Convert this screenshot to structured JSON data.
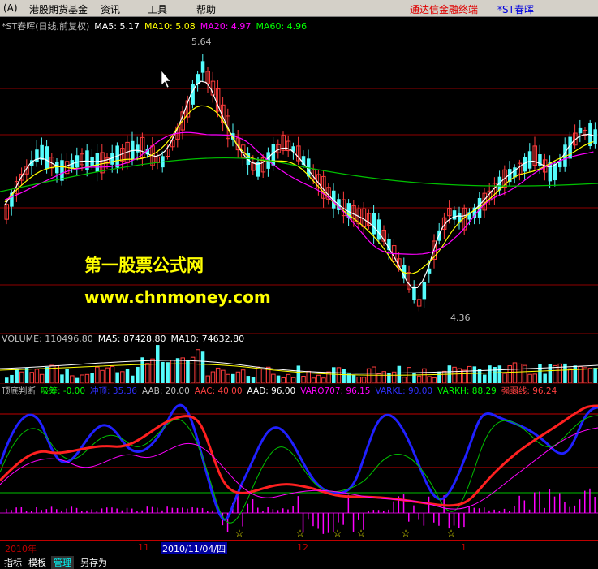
{
  "menu": {
    "items": [
      "(A)",
      "港股期货基金",
      "资讯",
      "工具",
      "帮助"
    ],
    "brand": "通达信金融终端",
    "stock": "*ST春晖"
  },
  "price_panel": {
    "legend": [
      {
        "text": "*ST春晖(日线,前复权)",
        "color": "#c0c0c0"
      },
      {
        "text": "MA5: 5.17",
        "color": "#ffffff"
      },
      {
        "text": "MA10: 5.08",
        "color": "#ffff00"
      },
      {
        "text": "MA20: 4.97",
        "color": "#ff00ff"
      },
      {
        "text": "MA60: 4.96",
        "color": "#00ff00"
      }
    ],
    "high_label": "5.64",
    "low_label": "4.36"
  },
  "watermark": {
    "line1": "第一股票公式网",
    "line2": "www.chnmoney.com"
  },
  "volume_panel": {
    "legend": [
      {
        "text": "VOLUME: 110496.80",
        "color": "#c0c0c0"
      },
      {
        "text": "MA5: 87428.80",
        "color": "#ffffff"
      },
      {
        "text": "MA10: 74632.80",
        "color": "#ffffff"
      }
    ]
  },
  "indicator_panel": {
    "legend": [
      {
        "text": "顶底判断",
        "color": "#c0c0c0"
      },
      {
        "text": "吸筹: -0.00",
        "color": "#00ff00"
      },
      {
        "text": "冲顶: 35.36",
        "color": "#0000ff"
      },
      {
        "text": "AAB: 20.00",
        "color": "#c0c0c0"
      },
      {
        "text": "AAC: 40.00",
        "color": "#ff4040"
      },
      {
        "text": "AAD: 96.00",
        "color": "#ffffff"
      },
      {
        "text": "VARO707: 96.15",
        "color": "#ff00ff"
      },
      {
        "text": "VARKL: 90.00",
        "color": "#0000ff"
      },
      {
        "text": "VARKH: 88.29",
        "color": "#00ff00"
      },
      {
        "text": "强弱线: 96.24",
        "color": "#ff4040"
      }
    ]
  },
  "axis": {
    "labels": [
      "2010年",
      "11",
      "2010/11/04/四",
      "12",
      "1"
    ]
  },
  "tabs": {
    "items": [
      "指标",
      "模板",
      "管理",
      "另存为"
    ],
    "active": "管理"
  },
  "colors": {
    "up": "#ff3c3c",
    "down": "#54fcfc",
    "grid": "#900000"
  }
}
